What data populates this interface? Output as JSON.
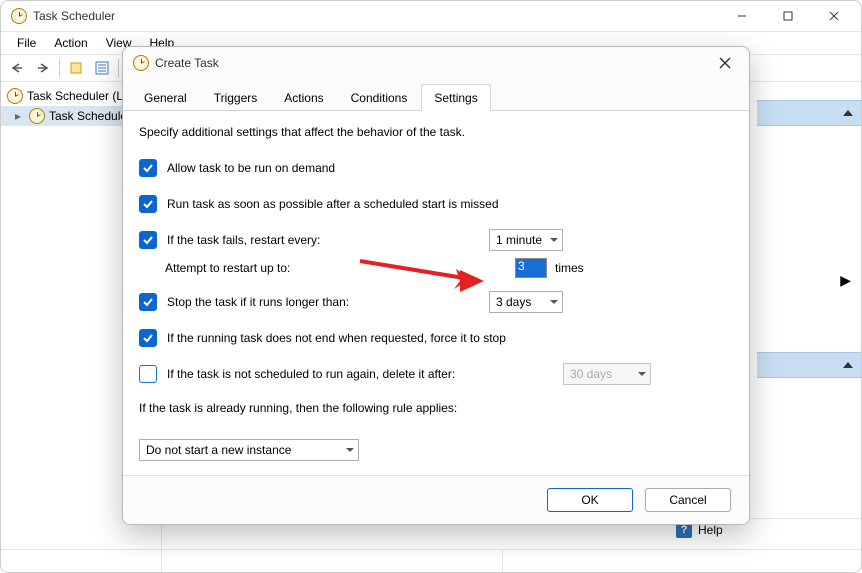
{
  "app": {
    "title": "Task Scheduler"
  },
  "menubar": [
    "File",
    "Action",
    "View",
    "Help"
  ],
  "tree": {
    "root": "Task Scheduler (L",
    "child": "Task Schedule"
  },
  "help_label": "Help",
  "dialog": {
    "title": "Create Task",
    "tabs": [
      "General",
      "Triggers",
      "Actions",
      "Conditions",
      "Settings"
    ],
    "active_tab": 4,
    "subhead": "Specify additional settings that affect the behavior of the task.",
    "opts": {
      "allow_demand": "Allow task to be run on demand",
      "run_missed": "Run task as soon as possible after a scheduled start is missed",
      "restart_every": "If the task fails, restart every:",
      "restart_every_val": "1 minute",
      "attempt_upto": "Attempt to restart up to:",
      "attempt_upto_val": "3",
      "attempt_suffix": "times",
      "stop_longer": "Stop the task if it runs longer than:",
      "stop_longer_val": "3 days",
      "force_stop": "If the running task does not end when requested, force it to stop",
      "delete_after": "If the task is not scheduled to run again, delete it after:",
      "delete_after_val": "30 days",
      "rule_label": "If the task is already running, then the following rule applies:",
      "rule_val": "Do not start a new instance"
    },
    "buttons": {
      "ok": "OK",
      "cancel": "Cancel"
    }
  }
}
